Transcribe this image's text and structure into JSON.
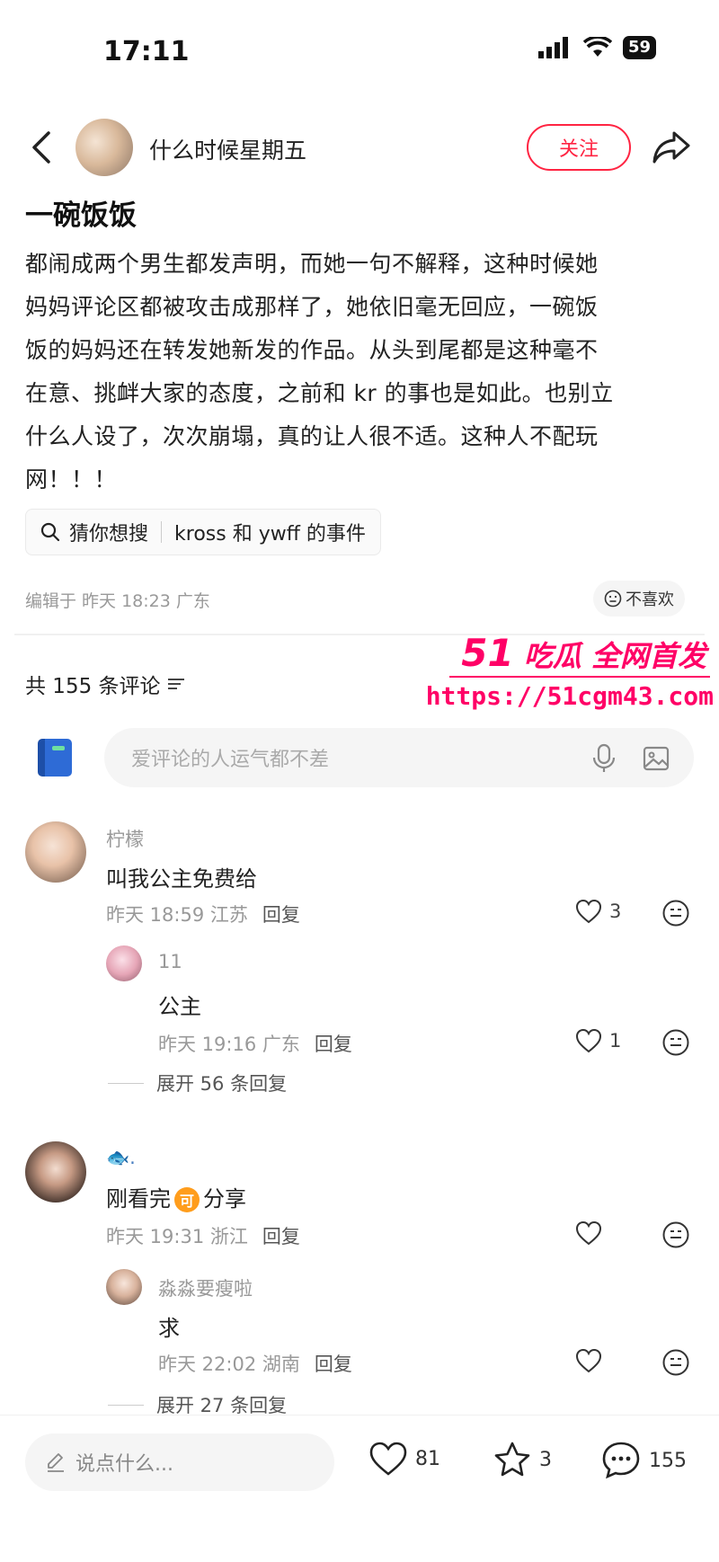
{
  "status": {
    "time": "17:11",
    "battery": "59"
  },
  "nav": {
    "author": "什么时候星期五",
    "follow": "关注"
  },
  "post": {
    "title": "一碗饭饭",
    "body_lines": [
      "都闹成两个男生都发声明，而她一句不解释，这种时候她",
      "妈妈评论区都被攻击成那样了，她依旧毫无回应，一碗饭",
      "饭的妈妈还在转发她新发的作品。从头到尾都是这种毫不",
      "在意、挑衅大家的态度，之前和 kr 的事也是如此。也别立",
      "什么人设了，次次崩塌，真的让人很不适。这种人不配玩",
      "网！！！"
    ],
    "search_label": "猜你想搜",
    "search_query": "kross 和 ywff 的事件",
    "meta": "编辑于 昨天 18:23 广东",
    "dislike": "不喜欢"
  },
  "comments_header": "共 155 条评论",
  "watermark": {
    "brand_num": "51",
    "brand_text": "吃瓜 全网首发",
    "url": "https://51cgm43.com"
  },
  "comment_input_placeholder": "爱评论的人运气都不差",
  "comments": [
    {
      "name": "柠檬",
      "text": "叫我公主免费给",
      "time": "昨天 18:59 江苏",
      "reply": "回复",
      "likes": "3"
    },
    {
      "name": "11",
      "text": "公主",
      "time": "昨天 19:16 广东",
      "reply": "回复",
      "likes": "1"
    },
    {
      "expand": "展开 56 条回复"
    },
    {
      "name": "🐟.",
      "text_a": "刚看完",
      "badge": "可",
      "text_b": "分享",
      "time": "昨天 19:31 浙江",
      "reply": "回复",
      "likes": ""
    },
    {
      "name": "淼淼要瘦啦",
      "text": "求",
      "time": "昨天 22:02 湖南",
      "reply": "回复",
      "likes": ""
    },
    {
      "expand": "展开 27 条回复"
    }
  ],
  "bottom": {
    "placeholder": "说点什么...",
    "likes": "81",
    "stars": "3",
    "comments": "155"
  },
  "colors": {
    "accent": "#ff2442",
    "watermark": "#ff0066"
  }
}
